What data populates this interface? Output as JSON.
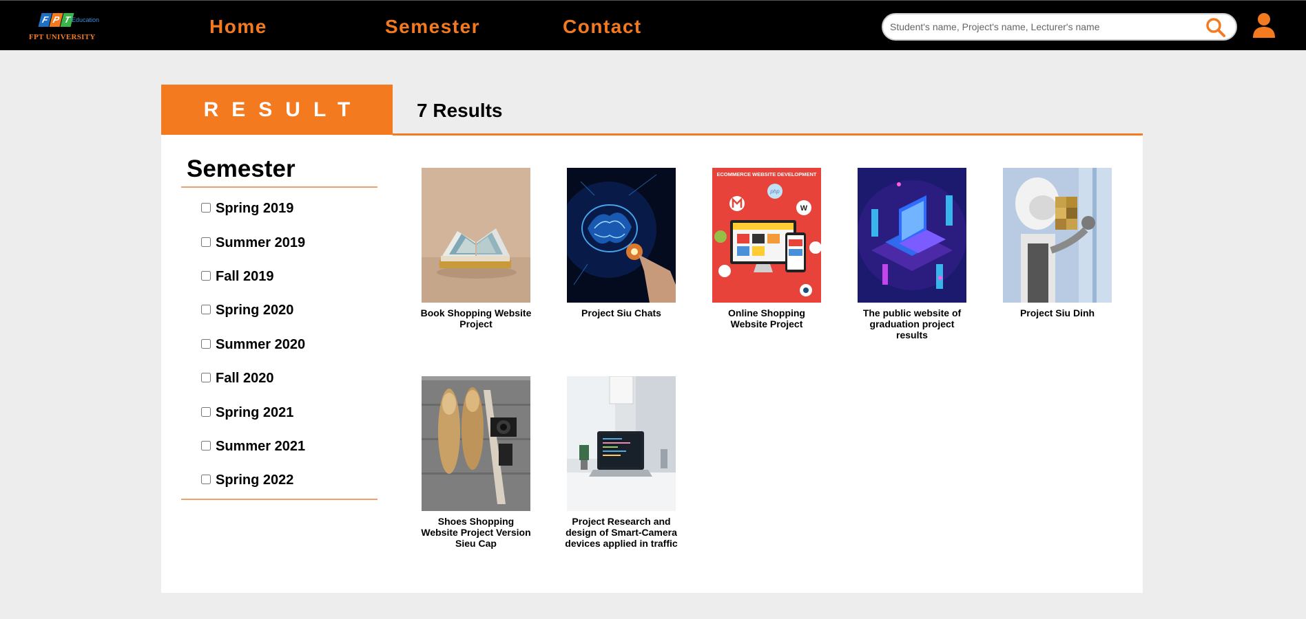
{
  "header": {
    "logo": {
      "edu_text": "Education",
      "name": "FPT UNIVERSITY",
      "mark_letters": [
        "F",
        "P",
        "T"
      ]
    },
    "nav": [
      {
        "label": "Home"
      },
      {
        "label": "Semester"
      },
      {
        "label": "Contact"
      }
    ],
    "search": {
      "placeholder": "Student's name, Project's name, Lecturer's name",
      "value": "",
      "icon": "search-icon"
    },
    "user_icon": "user-icon"
  },
  "result": {
    "tab_label": "RESULT",
    "count_text": "7 Results"
  },
  "sidebar": {
    "title": "Semester",
    "semesters": [
      {
        "label": "Spring 2019",
        "checked": false
      },
      {
        "label": "Summer 2019",
        "checked": false
      },
      {
        "label": "Fall 2019",
        "checked": false
      },
      {
        "label": "Spring 2020",
        "checked": false
      },
      {
        "label": "Summer 2020",
        "checked": false
      },
      {
        "label": "Fall 2020",
        "checked": false
      },
      {
        "label": "Spring 2021",
        "checked": false
      },
      {
        "label": "Summer 2021",
        "checked": false
      },
      {
        "label": "Spring 2022",
        "checked": false
      }
    ]
  },
  "projects": [
    {
      "title": "Book Shopping Website Project",
      "image": "open-book-photo"
    },
    {
      "title": "Project Siu Chats",
      "image": "digital-brain-hand-photo"
    },
    {
      "title": "Online Shopping Website Project",
      "image": "ecommerce-website-development-illustration",
      "image_text": "ECOMMERCE WEBSITE DEVELOPMENT"
    },
    {
      "title": "The public website of graduation project results",
      "image": "isometric-laptop-illustration"
    },
    {
      "title": "Project Siu Dinh",
      "image": "robot-cube-photo"
    },
    {
      "title": "Shoes Shopping Website Project Version Sieu Cap",
      "image": "shoes-camera-photo"
    },
    {
      "title": "Project Research and design of Smart-Camera devices applied in traffic",
      "image": "laptop-desk-photo"
    }
  ],
  "colors": {
    "accent": "#f47a20",
    "header_bg": "#000000",
    "page_bg": "#ededed"
  }
}
